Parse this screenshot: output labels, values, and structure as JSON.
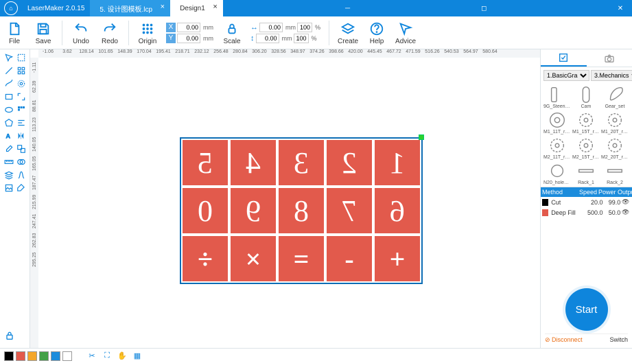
{
  "title_bar": {
    "app": "LaserMaker 2.0.15"
  },
  "tabs": [
    {
      "label": "5. 设计图模板.lcp",
      "active": false
    },
    {
      "label": "Design1",
      "active": true
    }
  ],
  "toolbar": {
    "file": "File",
    "save": "Save",
    "undo": "Undo",
    "redo": "Redo",
    "origin": "Origin",
    "scale": "Scale",
    "create": "Create",
    "help": "Help",
    "advice": "Advice",
    "x": "0.00",
    "y": "0.00",
    "x_unit": "mm",
    "y_unit": "mm",
    "w": "0.00",
    "h": "0.00",
    "wp": "100",
    "hp": "100",
    "pu": "%",
    "mm": "mm"
  },
  "ruler_h": [
    "-1.06",
    "3.62",
    "128.14",
    "101.65",
    "148.39",
    "170.04",
    "195.41",
    "218.71",
    "232.12",
    "256.48",
    "280.84",
    "306.20",
    "328.56",
    "348.97",
    "374.26",
    "398.66",
    "420.00",
    "445.45",
    "467.72",
    "471.59",
    "516.26",
    "540.53",
    "564.97",
    "580.64"
  ],
  "ruler_v": [
    "-1.11",
    "62.39",
    "88.81",
    "113.23",
    "140.05",
    "165.05",
    "187.47",
    "215.99",
    "247.41",
    "262.83",
    "295.25"
  ],
  "cells": [
    [
      "5",
      "4",
      "3",
      "2",
      "1"
    ],
    [
      "0",
      "9",
      "8",
      "7",
      "6"
    ],
    [
      "÷",
      "×",
      "=",
      "-",
      "+"
    ]
  ],
  "library": {
    "filter1": "1.BasicGra",
    "filter2": "3.Mechanics",
    "items": [
      "9G_Steering...",
      "Cam",
      "Gear_set",
      "M1_11T_rou...",
      "M1_15T_rou...",
      "M1_20T_rou...",
      "M2_11T_rou...",
      "M2_15T_rou...",
      "M2_20T_rou...",
      "N20_hole_p...",
      "Rack_1",
      "Rack_2"
    ]
  },
  "layers": {
    "head": [
      "Method",
      "Speed",
      "Power",
      "Output"
    ],
    "rows": [
      {
        "color": "#000000",
        "method": "Cut",
        "speed": "20.0",
        "power": "99.0"
      },
      {
        "color": "#e25a4c",
        "method": "Deep Fill",
        "speed": "500.0",
        "power": "50.0"
      }
    ]
  },
  "start": "Start",
  "conn": {
    "disconnect": "Disconnect",
    "switch": "Switch"
  },
  "swatches": [
    "#000000",
    "#e25a4c",
    "#f4a62a",
    "#43a047",
    "#1c8cdc",
    "#ffffff"
  ]
}
